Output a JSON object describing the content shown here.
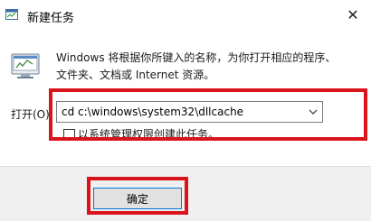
{
  "window": {
    "title": "新建任务",
    "close_glyph": "✕"
  },
  "description": "Windows 将根据你所键入的名称，为你打开相应的程序、文件夹、文档或 Internet 资源。",
  "open_label": "打开(O):",
  "command_value": "cd c:\\windows\\system32\\dllcache",
  "admin_checkbox": {
    "label": "以系统管理权限创建此任务。",
    "checked": false
  },
  "ok_button": "确定",
  "colors": {
    "highlight": "#d9141b",
    "button_focus": "#0078d7",
    "footer_bg": "#f0f0f0"
  },
  "icons": [
    "task-manager-icon",
    "run-program-icon",
    "chevron-down-icon",
    "close-icon"
  ]
}
